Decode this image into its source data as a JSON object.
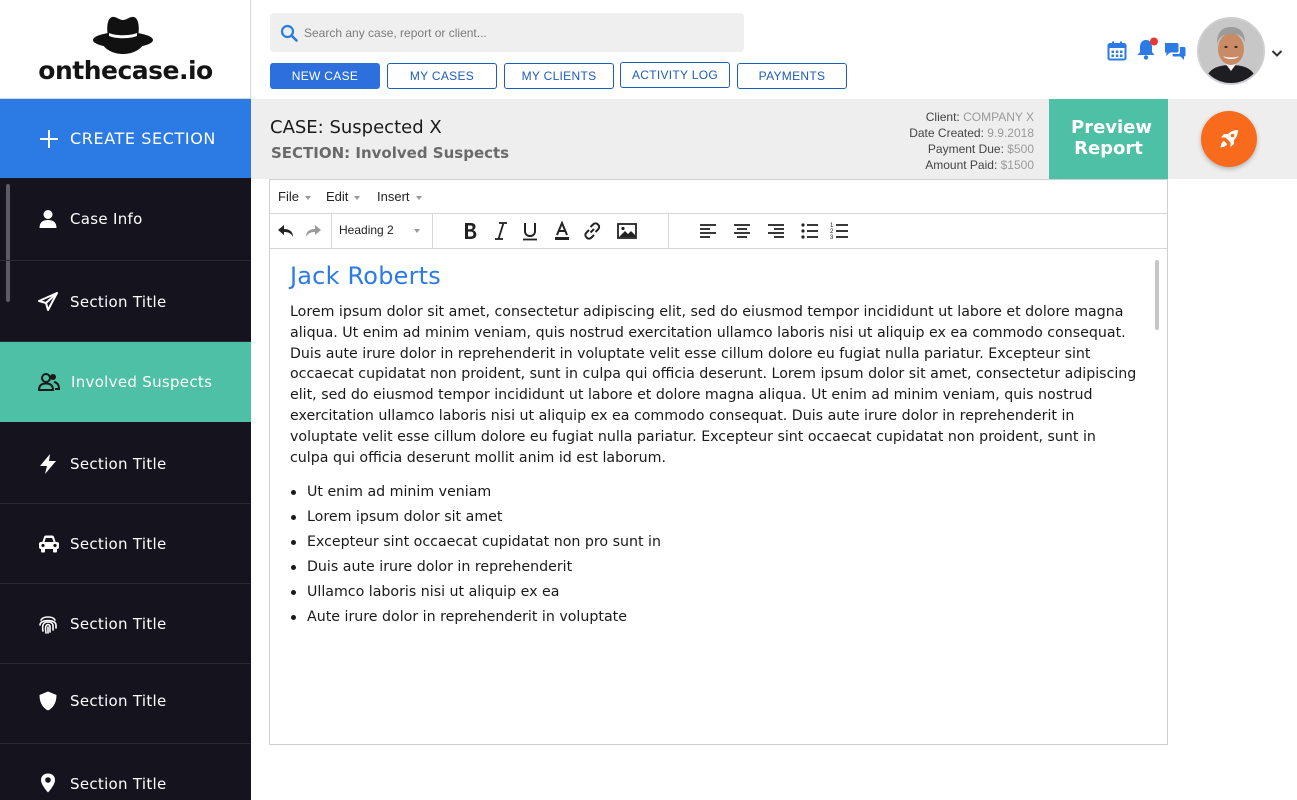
{
  "brand": {
    "name": "onthecase.io"
  },
  "search": {
    "placeholder": "Search any case, report or client..."
  },
  "nav": [
    {
      "label": "NEW CASE"
    },
    {
      "label": "MY CASES"
    },
    {
      "label": "MY CLIENTS"
    },
    {
      "label": "ACTIVITY LOG"
    },
    {
      "label": "PAYMENTS"
    }
  ],
  "header_icons": [
    "calendar-icon",
    "bell-icon",
    "chat-icon"
  ],
  "notification_dot": true,
  "sidebar": {
    "create_label": "CREATE SECTION",
    "items": [
      {
        "label": "Case Info",
        "icon": "user-icon",
        "active": false
      },
      {
        "label": "Section Title",
        "icon": "paper-plane-icon",
        "active": false
      },
      {
        "label": "Involved Suspects",
        "icon": "users-icon",
        "active": true
      },
      {
        "label": "Section Title",
        "icon": "lightning-icon",
        "active": false
      },
      {
        "label": "Section Title",
        "icon": "car-icon",
        "active": false
      },
      {
        "label": "Section Title",
        "icon": "fingerprint-icon",
        "active": false
      },
      {
        "label": "Section Title",
        "icon": "shield-icon",
        "active": false
      },
      {
        "label": "Section Title",
        "icon": "map-pin-icon",
        "active": false
      }
    ]
  },
  "case": {
    "title": "CASE: Suspected X",
    "section": "SECTION: Involved Suspects",
    "meta": {
      "client_label": "Client:",
      "client_value": "COMPANY X",
      "date_label": "Date Created:",
      "date_value": "9.9.2018",
      "due_label": "Payment Due:",
      "due_value": "$500",
      "paid_label": "Amount Paid:",
      "paid_value": "$1500"
    },
    "preview_label": "Preview Report"
  },
  "editor": {
    "menus": [
      "File",
      "Edit",
      "Insert"
    ],
    "format_value": "Heading 2",
    "heading": "Jack Roberts",
    "paragraph": "Lorem ipsum dolor sit amet, consectetur adipiscing elit, sed do eiusmod tempor incididunt ut labore et dolore magna aliqua. Ut enim ad minim veniam, quis nostrud exercitation ullamco laboris nisi ut aliquip ex ea commodo consequat. Duis aute irure dolor in reprehenderit in voluptate velit esse cillum dolore eu fugiat nulla pariatur. Excepteur sint occaecat cupidatat non proident, sunt in culpa qui officia deserunt. Lorem ipsum dolor sit amet, consectetur adipiscing elit, sed do eiusmod tempor incididunt ut labore et dolore magna aliqua. Ut enim ad minim veniam, quis nostrud exercitation ullamco laboris nisi ut aliquip ex ea commodo consequat. Duis aute irure dolor in reprehenderit in voluptate velit esse cillum dolore eu fugiat nulla pariatur. Excepteur sint occaecat cupidatat non proident, sunt in culpa qui officia deserunt mollit anim id est laborum.",
    "bullets": [
      "Ut enim ad minim veniam",
      "Lorem ipsum dolor sit amet",
      "Excepteur sint occaecat cupidatat non pro sunt in",
      "Duis aute irure dolor in reprehenderit",
      "Ullamco laboris nisi ut aliquip ex ea",
      "Aute irure dolor in reprehenderit in voluptate"
    ]
  },
  "colors": {
    "brand_blue": "#2c7be5",
    "teal": "#4ec0a5",
    "sidebar_bg": "#14131e",
    "rocket_orange": "#f86b1c",
    "notification_red": "#e53935"
  }
}
